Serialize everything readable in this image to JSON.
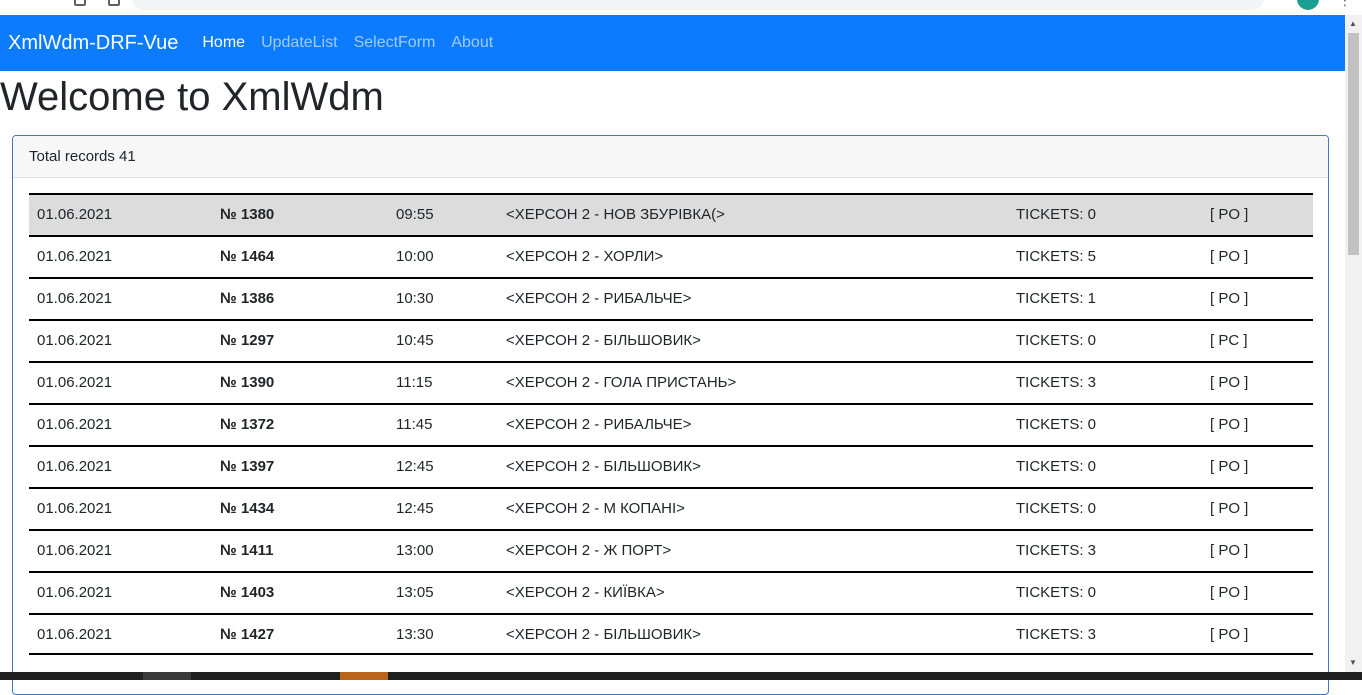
{
  "navbar": {
    "brand": "XmlWdm-DRF-Vue",
    "links": [
      {
        "label": "Home",
        "active": true
      },
      {
        "label": "UpdateList",
        "active": false
      },
      {
        "label": "SelectForm",
        "active": false
      },
      {
        "label": "About",
        "active": false
      }
    ]
  },
  "page": {
    "title": "Welcome to XmlWdm"
  },
  "card": {
    "header": "Total records 41"
  },
  "records": [
    {
      "date": "01.06.2021",
      "number": "№ 1380",
      "time": "09:55",
      "route": "<ХЕРСОН 2 - НОВ ЗБУРІВКА(>",
      "tickets": "TICKETS: 0",
      "status": "[ PO ]",
      "highlighted": true
    },
    {
      "date": "01.06.2021",
      "number": "№ 1464",
      "time": "10:00",
      "route": "<ХЕРСОН 2 - ХОРЛИ>",
      "tickets": "TICKETS: 5",
      "status": "[ PO ]"
    },
    {
      "date": "01.06.2021",
      "number": "№ 1386",
      "time": "10:30",
      "route": "<ХЕРСОН 2 - РИБАЛЬЧЕ>",
      "tickets": "TICKETS: 1",
      "status": "[ PO ]"
    },
    {
      "date": "01.06.2021",
      "number": "№ 1297",
      "time": "10:45",
      "route": "<ХЕРСОН 2 - БІЛЬШОВИК>",
      "tickets": "TICKETS: 0",
      "status": "[ PC ]"
    },
    {
      "date": "01.06.2021",
      "number": "№ 1390",
      "time": "11:15",
      "route": "<ХЕРСОН 2 - ГОЛА ПРИСТАНЬ>",
      "tickets": "TICKETS: 3",
      "status": "[ PO ]"
    },
    {
      "date": "01.06.2021",
      "number": "№ 1372",
      "time": "11:45",
      "route": "<ХЕРСОН 2 - РИБАЛЬЧЕ>",
      "tickets": "TICKETS: 0",
      "status": "[ PO ]"
    },
    {
      "date": "01.06.2021",
      "number": "№ 1397",
      "time": "12:45",
      "route": "<ХЕРСОН 2 - БІЛЬШОВИК>",
      "tickets": "TICKETS: 0",
      "status": "[ PO ]"
    },
    {
      "date": "01.06.2021",
      "number": "№ 1434",
      "time": "12:45",
      "route": "<ХЕРСОН 2 - М КОПАНІ>",
      "tickets": "TICKETS: 0",
      "status": "[ PO ]"
    },
    {
      "date": "01.06.2021",
      "number": "№ 1411",
      "time": "13:00",
      "route": "<ХЕРСОН 2 - Ж ПОРТ>",
      "tickets": "TICKETS: 3",
      "status": "[ PO ]"
    },
    {
      "date": "01.06.2021",
      "number": "№ 1403",
      "time": "13:05",
      "route": "<ХЕРСОН 2 - КИЇВКА>",
      "tickets": "TICKETS: 0",
      "status": "[ PO ]"
    },
    {
      "date": "01.06.2021",
      "number": "№ 1427",
      "time": "13:30",
      "route": "<ХЕРСОН 2 - БІЛЬШОВИК>",
      "tickets": "TICKETS: 3",
      "status": "[ PO ]"
    }
  ],
  "scrollbar": {
    "up_icon": "scroll-up-arrow",
    "down_icon": "scroll-down-arrow"
  },
  "colors": {
    "navbar": "#0d7bfd",
    "highlight_row": "#dcdcdc",
    "card_border": "#3d79c8"
  }
}
